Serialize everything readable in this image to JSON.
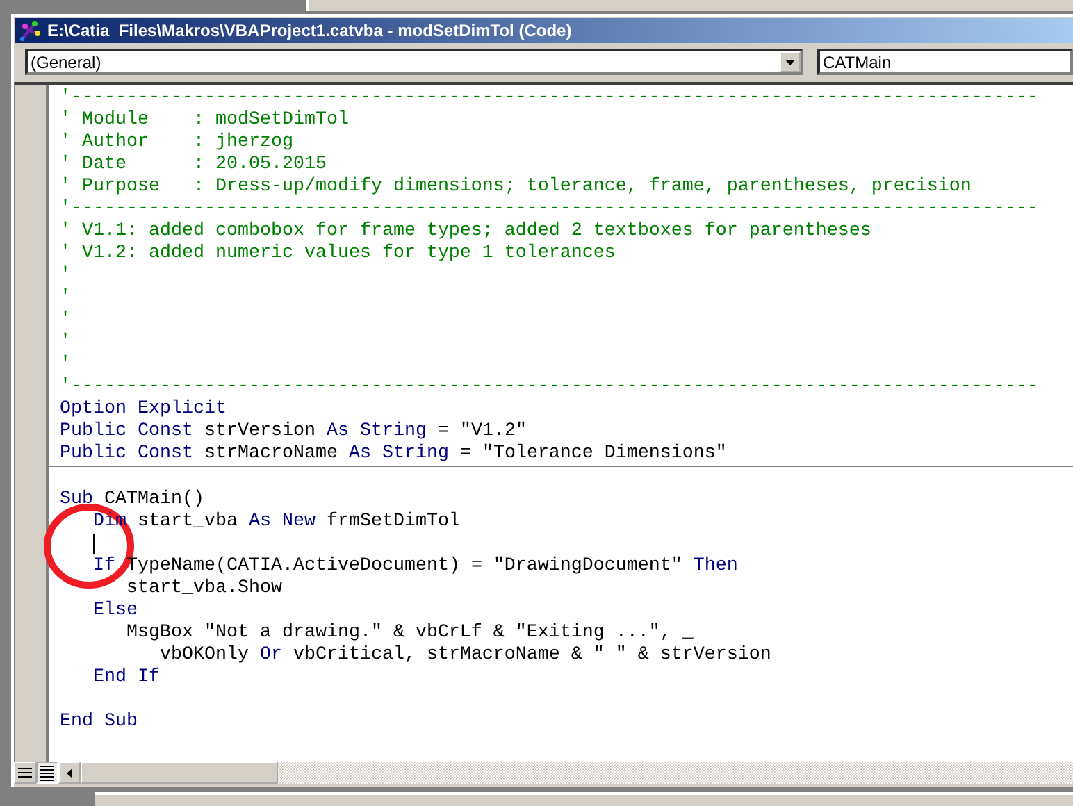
{
  "window": {
    "title": "E:\\Catia_Files\\Makros\\VBAProject1.catvba - modSetDimTol (Code)"
  },
  "object_dropdown": {
    "value": "(General)"
  },
  "procedure_dropdown": {
    "value": "CATMain"
  },
  "code_sections": [
    {
      "lines": [
        {
          "kind": "code",
          "segments": [
            {
              "kind": "comment",
              "text": "'---------------------------------------------------------------------------------------"
            }
          ]
        },
        {
          "kind": "code",
          "segments": [
            {
              "kind": "comment",
              "text": "' Module    : modSetDimTol"
            }
          ]
        },
        {
          "kind": "code",
          "segments": [
            {
              "kind": "comment",
              "text": "' Author    : jherzog"
            }
          ]
        },
        {
          "kind": "code",
          "segments": [
            {
              "kind": "comment",
              "text": "' Date      : 20.05.2015"
            }
          ]
        },
        {
          "kind": "code",
          "segments": [
            {
              "kind": "comment",
              "text": "' Purpose   : Dress-up/modify dimensions; tolerance, frame, parentheses, precision"
            }
          ]
        },
        {
          "kind": "code",
          "segments": [
            {
              "kind": "comment",
              "text": "'---------------------------------------------------------------------------------------"
            }
          ]
        },
        {
          "kind": "code",
          "segments": [
            {
              "kind": "comment",
              "text": "' V1.1: added combobox for frame types; added 2 textboxes for parentheses"
            }
          ]
        },
        {
          "kind": "code",
          "segments": [
            {
              "kind": "comment",
              "text": "' V1.2: added numeric values for type 1 tolerances"
            }
          ]
        },
        {
          "kind": "code",
          "segments": [
            {
              "kind": "comment",
              "text": "'"
            }
          ]
        },
        {
          "kind": "code",
          "segments": [
            {
              "kind": "comment",
              "text": "'"
            }
          ]
        },
        {
          "kind": "code",
          "segments": [
            {
              "kind": "comment",
              "text": "'"
            }
          ]
        },
        {
          "kind": "code",
          "segments": [
            {
              "kind": "comment",
              "text": "'"
            }
          ]
        },
        {
          "kind": "code",
          "segments": [
            {
              "kind": "comment",
              "text": "'"
            }
          ]
        },
        {
          "kind": "code",
          "segments": [
            {
              "kind": "comment",
              "text": "'---------------------------------------------------------------------------------------"
            }
          ]
        },
        {
          "kind": "code",
          "segments": [
            {
              "kind": "keyword",
              "text": "Option Explicit"
            }
          ]
        },
        {
          "kind": "code",
          "segments": [
            {
              "kind": "keyword",
              "text": "Public Const"
            },
            {
              "kind": "plain",
              "text": " strVersion "
            },
            {
              "kind": "keyword",
              "text": "As String"
            },
            {
              "kind": "plain",
              "text": " = \"V1.2\""
            }
          ]
        },
        {
          "kind": "code",
          "segments": [
            {
              "kind": "keyword",
              "text": "Public Const"
            },
            {
              "kind": "plain",
              "text": " strMacroName "
            },
            {
              "kind": "keyword",
              "text": "As String"
            },
            {
              "kind": "plain",
              "text": " = \"Tolerance Dimensions\""
            }
          ]
        }
      ]
    },
    {
      "lines": [
        {
          "kind": "blank"
        },
        {
          "kind": "code",
          "segments": [
            {
              "kind": "keyword",
              "text": "Sub"
            },
            {
              "kind": "plain",
              "text": " CATMain()"
            }
          ]
        },
        {
          "kind": "code",
          "segments": [
            {
              "kind": "keyword",
              "text": "   Dim"
            },
            {
              "kind": "plain",
              "text": " start_vba "
            },
            {
              "kind": "keyword",
              "text": "As New"
            },
            {
              "kind": "plain",
              "text": " frmSetDimTol"
            }
          ]
        },
        {
          "kind": "cursor"
        },
        {
          "kind": "code",
          "segments": [
            {
              "kind": "keyword",
              "text": "   If"
            },
            {
              "kind": "plain",
              "text": " TypeName(CATIA.ActiveDocument) = \"DrawingDocument\" "
            },
            {
              "kind": "keyword",
              "text": "Then"
            }
          ]
        },
        {
          "kind": "code",
          "segments": [
            {
              "kind": "plain",
              "text": "      start_vba.Show"
            }
          ]
        },
        {
          "kind": "code",
          "segments": [
            {
              "kind": "keyword",
              "text": "   Else"
            }
          ]
        },
        {
          "kind": "code",
          "segments": [
            {
              "kind": "plain",
              "text": "      MsgBox \"Not a drawing.\" & vbCrLf & \"Exiting ...\", _"
            }
          ]
        },
        {
          "kind": "code",
          "segments": [
            {
              "kind": "plain",
              "text": "         vbOKOnly "
            },
            {
              "kind": "keyword",
              "text": "Or"
            },
            {
              "kind": "plain",
              "text": " vbCritical, strMacroName & \" \" & strVersion"
            }
          ]
        },
        {
          "kind": "code",
          "segments": [
            {
              "kind": "keyword",
              "text": "   End If"
            }
          ]
        },
        {
          "kind": "blank"
        },
        {
          "kind": "code",
          "segments": [
            {
              "kind": "keyword",
              "text": "End Sub"
            }
          ]
        }
      ]
    }
  ]
}
